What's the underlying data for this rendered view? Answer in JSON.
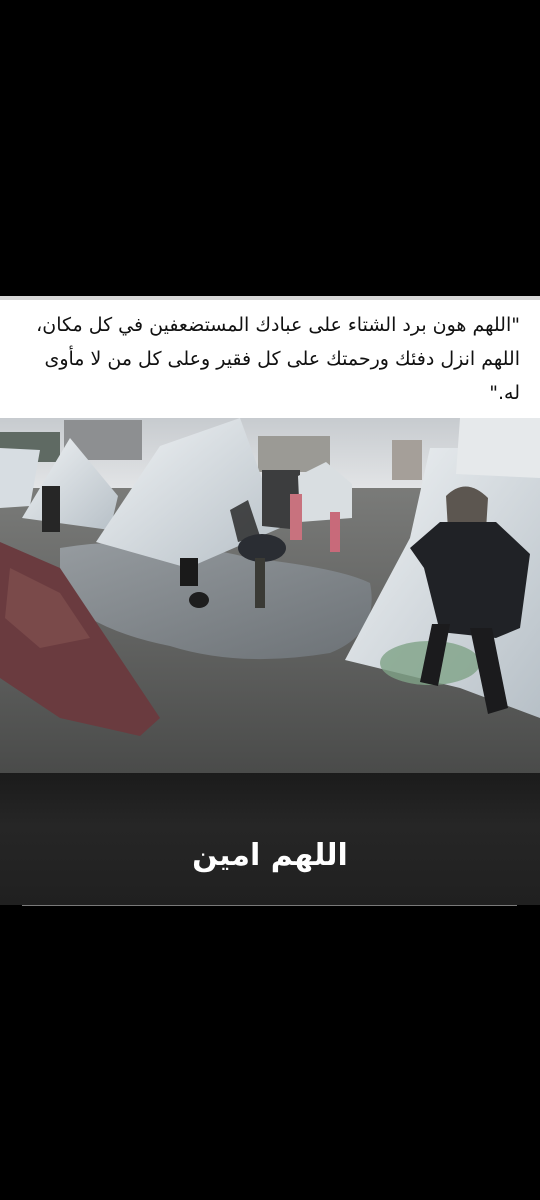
{
  "post": {
    "prayer_text": "\"اللهم هون برد الشتاء على عبادك المستضعفين في كل مكان، اللهم انزل دفئك ورحمتك على كل فقير وعلى كل من لا مأوى له.\"",
    "caption": "اللهم امين"
  },
  "photo": {
    "subject": "flooded-tent-camp",
    "colors": {
      "sky": "#cfd3d6",
      "ground": "#6d6d6b",
      "water": "#8a8f93",
      "tent": "#dfe4e8",
      "carpet": "#6b3a3e"
    }
  }
}
